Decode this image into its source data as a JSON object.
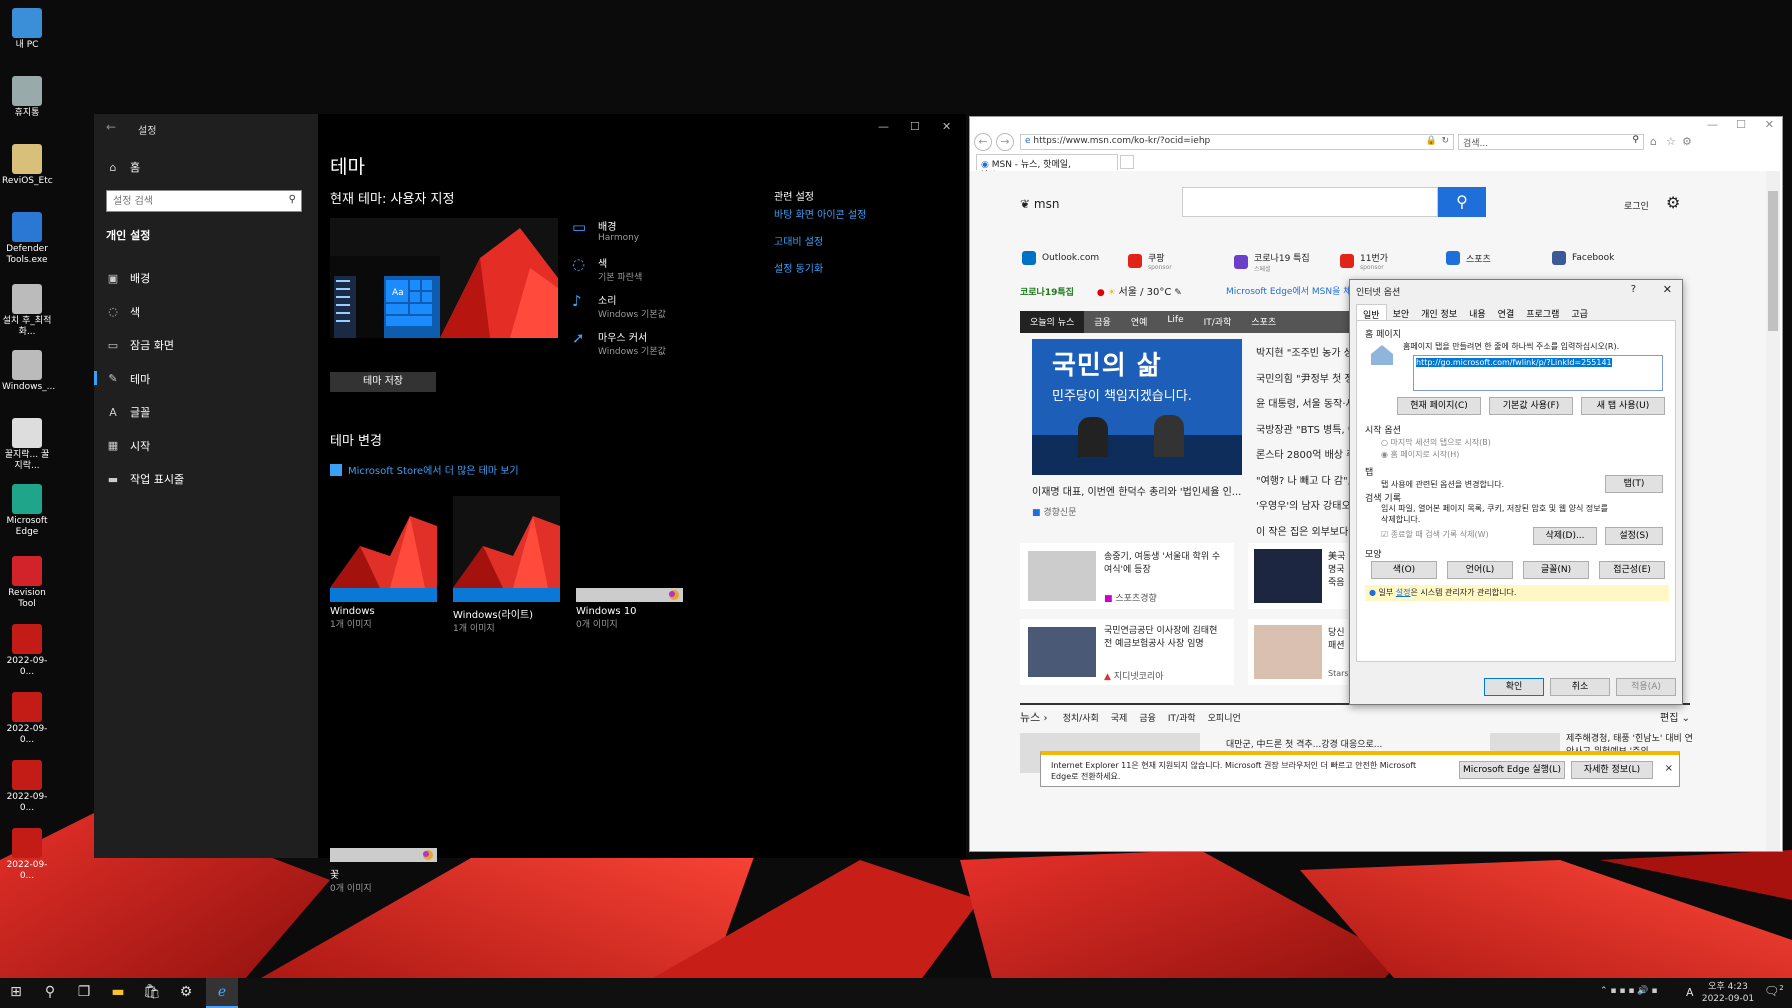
{
  "desktop_icons": [
    {
      "label": "내 PC"
    },
    {
      "label": "휴지통"
    },
    {
      "label": "ReviOS_Etc"
    },
    {
      "label": "Defender Tools.exe"
    },
    {
      "label": "설치 후_최적화..."
    },
    {
      "label": "Windows_..."
    },
    {
      "label": "꿀지락... 꿀지락..."
    },
    {
      "label": "Microsoft Edge"
    },
    {
      "label": "Revision Tool"
    },
    {
      "label": "2022-09-0..."
    },
    {
      "label": "2022-09-0..."
    },
    {
      "label": "2022-09-0..."
    },
    {
      "label": "2022-09-0..."
    }
  ],
  "settings": {
    "window_title": "설정",
    "home": "홈",
    "search_placeholder": "설정 검색",
    "section": "개인 설정",
    "nav": [
      {
        "label": "배경",
        "icon": "image-icon"
      },
      {
        "label": "색",
        "icon": "palette-icon"
      },
      {
        "label": "잠금 화면",
        "icon": "lock-screen-icon"
      },
      {
        "label": "테마",
        "icon": "theme-icon"
      },
      {
        "label": "글꼴",
        "icon": "font-icon"
      },
      {
        "label": "시작",
        "icon": "start-icon"
      },
      {
        "label": "작업 표시줄",
        "icon": "taskbar-icon"
      }
    ],
    "page_title": "테마",
    "current_theme": "현재 테마: 사용자 지정",
    "props": [
      {
        "name": "배경",
        "value": "Harmony"
      },
      {
        "name": "색",
        "value": "기본 파란색"
      },
      {
        "name": "소리",
        "value": "Windows 기본값"
      },
      {
        "name": "마우스 커서",
        "value": "Windows 기본값"
      }
    ],
    "save_button": "테마 저장",
    "related_title": "관련 설정",
    "related": [
      "바탕 화면 아이콘 설정",
      "고대비 설정",
      "설정 동기화"
    ],
    "change_title": "테마 변경",
    "store_link": "Microsoft Store에서 더 많은 테마 보기",
    "themes": [
      {
        "name": "Windows",
        "count": "1개 이미지"
      },
      {
        "name": "Windows(라이트)",
        "count": "1개 이미지"
      },
      {
        "name": "Windows 10",
        "count": "0개 이미지"
      },
      {
        "name": "꽃",
        "count": "0개 이미지"
      }
    ]
  },
  "ie": {
    "url": "https://www.msn.com/ko-kr/?ocid=iehp",
    "search_placeholder": "검색...",
    "tab_title": "MSN - 뉴스, 핫메일, Hotm...",
    "msn_logo": "msn",
    "login": "로그인",
    "quick_links": [
      {
        "label": "Outlook.com",
        "sub": ""
      },
      {
        "label": "쿠팡",
        "sub": "sponsor"
      },
      {
        "label": "코로나19 특집",
        "sub": "스페셜"
      },
      {
        "label": "11번가",
        "sub": "sponsor"
      },
      {
        "label": "스포츠",
        "sub": ""
      },
      {
        "label": "Facebook",
        "sub": ""
      }
    ],
    "covid": "코로나19특집",
    "weather": "서울 / 30°C",
    "edge_promo": "Microsoft Edge에서 MSN을 체",
    "news_tabs": [
      "오늘의 뉴스",
      "금융",
      "연예",
      "Life",
      "IT/과학",
      "스포츠"
    ],
    "hero_text1": "국민의 삶",
    "hero_text2": "민주당이 책임지겠습니다.",
    "hero_caption": "이재명 대표, 이번엔 한덕수 총리와 '법인세율 인...",
    "hero_source": "경향신문",
    "headlines": [
      "박지현 \"조주빈 농가 상",
      "국민의힘 \"尹정부 첫 정",
      "윤 대통령, 서울 동작·사",
      "국방장관 \"BTS 병특, 여",
      "론스타 2800억 배상 취",
      "\"여행? 나 빼고 다 감\",",
      "'우영우'의 남자 강태오",
      "이 작은 집은 외부보다"
    ],
    "card1_text": "송중기, 여동생 '서울대 학위 수여식'에 등장",
    "card1_src": "스포츠경향",
    "card2_text": "美국 명국 죽음",
    "card3_text": "국민연금공단 이사장에 김태현 전 예금보험공사 사장 임명",
    "card3_src": "지디넷코리아",
    "card4_text": "당신 패션",
    "card4_src": "StarsInsider",
    "news_label": "뉴스",
    "news_cats": [
      "정치/사회",
      "국제",
      "금융",
      "IT/과학",
      "오피니언"
    ],
    "edit": "편집",
    "bottom1": "대만군, 中드론 첫 격추...강경 대응으로...",
    "bottom2": "제주해경청, 태풍 '힌남노' 대비 연안사고 위험예보 '주의",
    "notice": "Internet Explorer 11은 현재 지원되지 않습니다. Microsoft 권장 브라우저인 더 빠르고 안전한 Microsoft Edge로 전환하세요.",
    "notice_btn1": "Microsoft Edge 실행(L)",
    "notice_btn2": "자세한 정보(L)"
  },
  "dialog": {
    "title": "인터넷 옵션",
    "tabs": [
      "일반",
      "보안",
      "개인 정보",
      "내용",
      "연결",
      "프로그램",
      "고급"
    ],
    "home_group": "홈 페이지",
    "home_desc": "홈페이지 탭을 만들려면 한 줄에 하나씩 주소를 입력하십시오(R).",
    "home_url": "http://go.microsoft.com/fwlink/p/?LinkId=255141",
    "btn_current": "현재 페이지(C)",
    "btn_default": "기본값 사용(F)",
    "btn_newtab": "새 탭 사용(U)",
    "startup_group": "시작 옵션",
    "opt1": "마지막 세션의 탭으로 시작(B)",
    "opt2": "홈 페이지로 시작(H)",
    "tab_group": "탭",
    "tab_desc": "탭 사용에 관련된 옵션을 변경합니다.",
    "tab_btn": "탭(T)",
    "history_group": "검색 기록",
    "history_desc": "임시 파일, 열어본 페이지 목록, 쿠키, 저장된 암호 및 웹 양식 정보를 삭제합니다.",
    "history_check": "종료할 때 검색 기록 삭제(W)",
    "btn_delete": "삭제(D)...",
    "btn_settings": "설정(S)",
    "appearance_group": "모양",
    "btn_color": "색(O)",
    "btn_lang": "언어(L)",
    "btn_font": "글꼴(N)",
    "btn_access": "접근성(E)",
    "admin_note_pre": "일부 ",
    "admin_note_link": "설정",
    "admin_note_post": "은 시스템 관리자가 관리합니다.",
    "ok": "확인",
    "cancel": "취소",
    "apply": "적용(A)"
  },
  "taskbar": {
    "time": "오후 4:23",
    "date": "2022-09-01",
    "ime": "A",
    "notif_count": "2"
  }
}
